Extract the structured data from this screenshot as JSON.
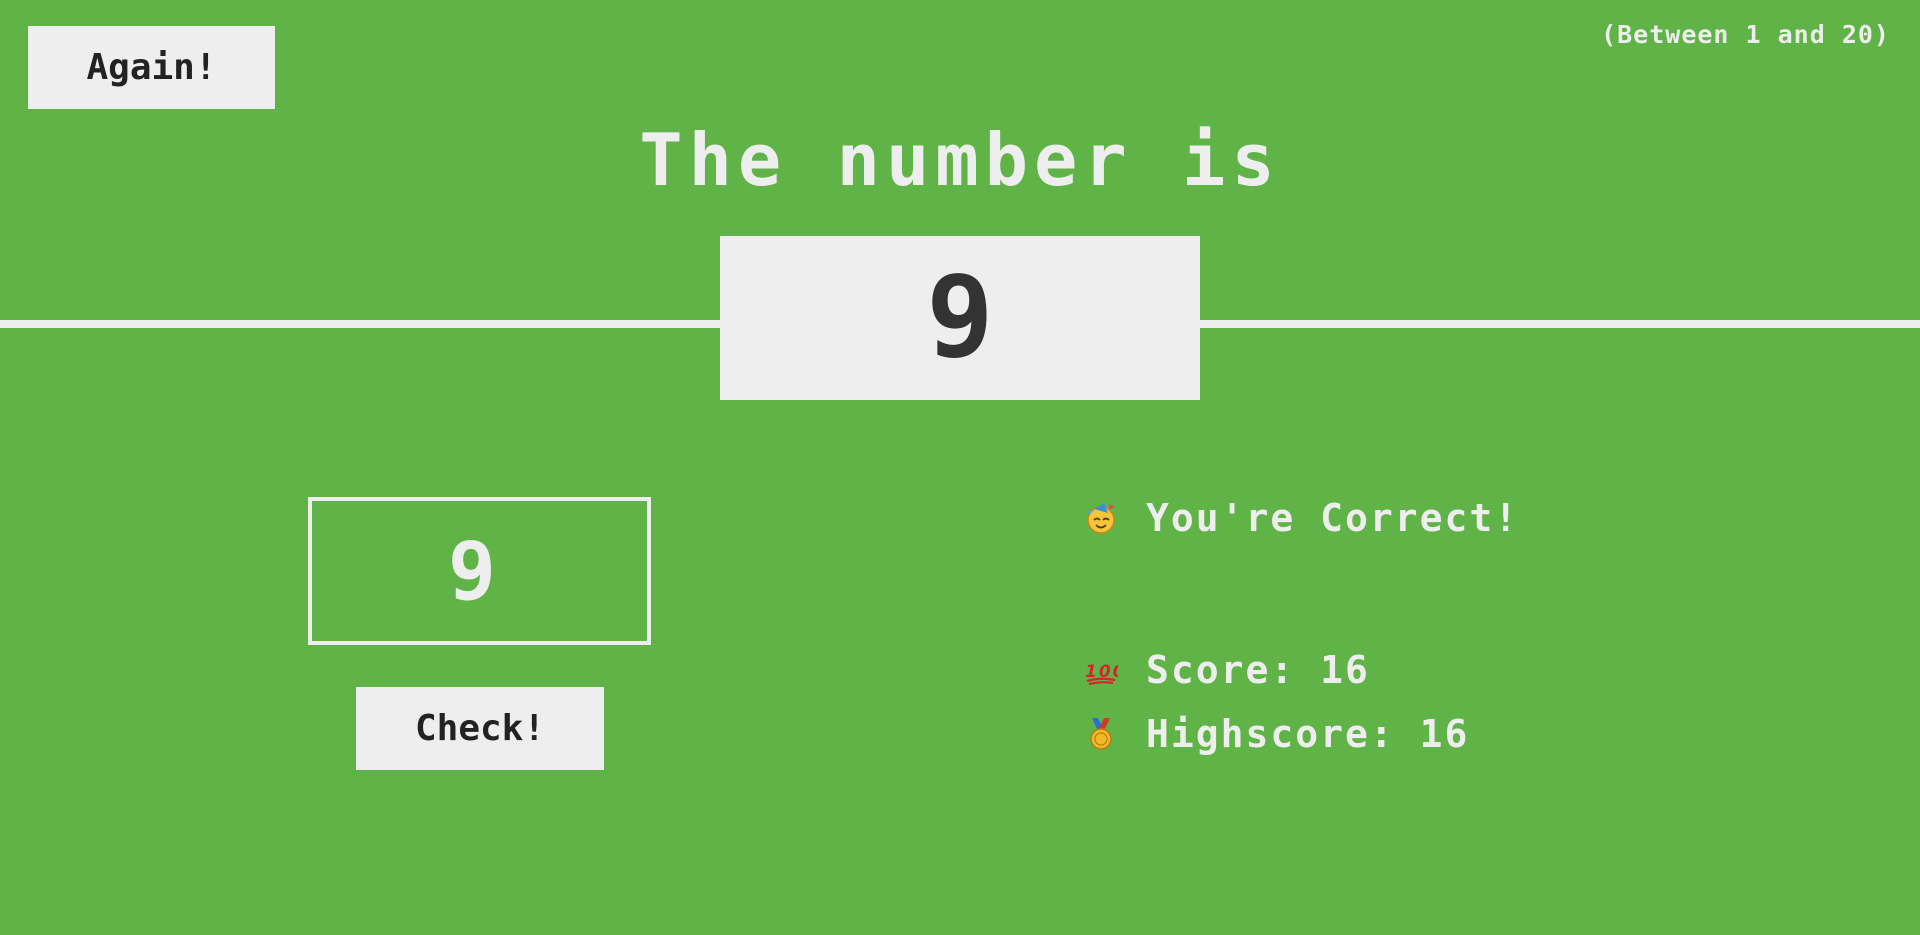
{
  "again_button": {
    "label": "Again!"
  },
  "range_hint": "(Between 1 and 20)",
  "headline": "The number is",
  "secret_number": "9",
  "guess": {
    "value": "9"
  },
  "check_button": {
    "label": "Check!"
  },
  "message": {
    "icon": "party-face-icon",
    "text": "You're Correct!"
  },
  "score": {
    "icon": "hundred-points-icon",
    "label": "Score:",
    "value": "16"
  },
  "highscore": {
    "icon": "medal-icon",
    "label": "Highscore:",
    "value": "16"
  },
  "colors": {
    "background": "#60b347",
    "foreground": "#eeeeee",
    "dark_text": "#333333"
  }
}
